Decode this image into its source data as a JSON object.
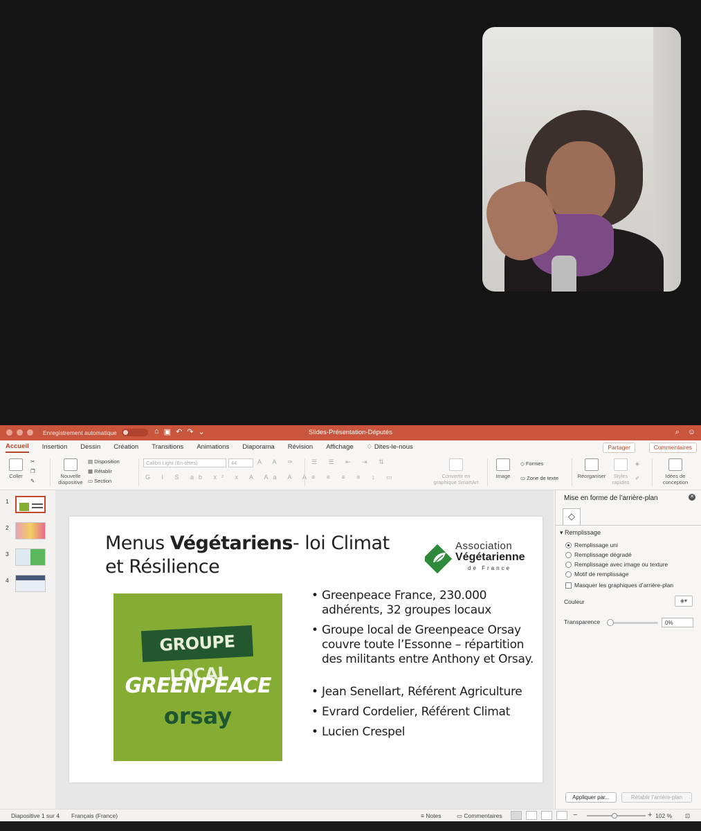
{
  "window": {
    "autosave_label": "Enregistrement automatique",
    "doc_title": "Slides-Présentation-Députés"
  },
  "tabs": [
    "Accueil",
    "Insertion",
    "Dessin",
    "Création",
    "Transitions",
    "Animations",
    "Diaporama",
    "Révision",
    "Affichage",
    "Dites-le-nous"
  ],
  "header_buttons": {
    "share": "Partager",
    "comments": "Commentaires"
  },
  "ribbon": {
    "paste": "Coller",
    "new_slide_1": "Nouvelle",
    "new_slide_2": "diapositive",
    "layout": "Disposition",
    "reset": "Rétablir",
    "section": "Section",
    "font_name": "Calibri Light (En-têtes)",
    "font_size": "44",
    "smartart_1": "Convertir en",
    "smartart_2": "graphique SmartArt",
    "image": "Image",
    "shapes": "Formes",
    "textbox": "Zone de texte",
    "arrange": "Réorganiser",
    "quick_styles_1": "Styles",
    "quick_styles_2": "rapides",
    "design_ideas_1": "Idées de",
    "design_ideas_2": "conception"
  },
  "thumbnails": [
    "1",
    "2",
    "3",
    "4"
  ],
  "slide": {
    "title_plain_1": "Menus ",
    "title_bold": "Végétariens",
    "title_plain_2": "- loi Climat et Résilience",
    "logo": {
      "line1": "Association",
      "line2": "Végétarienne",
      "line3": "de France"
    },
    "image": {
      "box_text": "GROUPE LOCAL",
      "word": "GREENPEACE",
      "city": "orsay"
    },
    "bullets": [
      "Greenpeace France, 230.000 adhérents, 32 groupes locaux",
      "Groupe local de Greenpeace Orsay couvre toute l’Essonne – répartition des militants entre Anthony et Orsay.",
      "Jean Senellart, Référent Agriculture",
      "Evrard Cordelier, Référent Climat",
      "Lucien Crespel"
    ]
  },
  "format_pane": {
    "title": "Mise en forme de l’arrière-plan",
    "section": "Remplissage",
    "options": [
      "Remplissage uni",
      "Remplissage dégradé",
      "Remplissage avec image ou texture",
      "Motif de remplissage"
    ],
    "hide_graphics": "Masquer les graphiques d’arrière-plan",
    "color_label": "Couleur",
    "transparency_label": "Transparence",
    "transparency_value": "0%",
    "apply_button": "Appliquer par...",
    "reset_button": "Rétablir l’arrière-plan"
  },
  "status": {
    "slide_info": "Diapositive 1 sur 4",
    "language": "Français (France)",
    "notes": "Notes",
    "comments": "Commentaires",
    "zoom": "102 %"
  },
  "colors": {
    "accent": "#c9553d",
    "greenpeace_bg": "#86ad33",
    "greenpeace_dark": "#23582f"
  }
}
